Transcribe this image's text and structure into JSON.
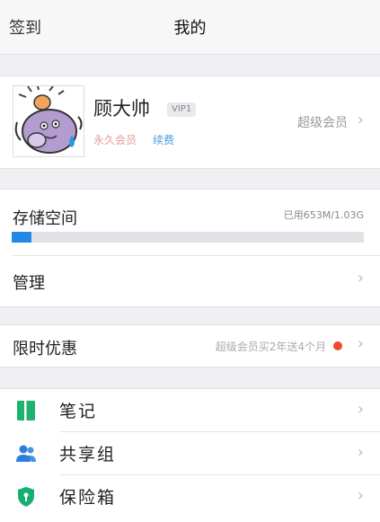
{
  "nav": {
    "left_label": "签到",
    "title": "我的"
  },
  "profile": {
    "name": "顾大帅",
    "vip_badge": "VIP1",
    "member_type": "永久会员",
    "renew": "续费",
    "upgrade_label": "超级会员"
  },
  "storage": {
    "label": "存储空间",
    "usage_text": "已用653M/1.03G",
    "used_fraction": 0.055,
    "manage_label": "管理"
  },
  "promo": {
    "label": "限时优惠",
    "desc": "超级会员买2年送4个月",
    "dot_color": "#ee4a33"
  },
  "menu": [
    {
      "label": "笔记",
      "icon": "notebook-icon",
      "color": "#1db36b"
    },
    {
      "label": "共享组",
      "icon": "group-icon",
      "color": "#2a7fde"
    },
    {
      "label": "保险箱",
      "icon": "shield-icon",
      "color": "#17b070"
    }
  ],
  "chevron": "›"
}
